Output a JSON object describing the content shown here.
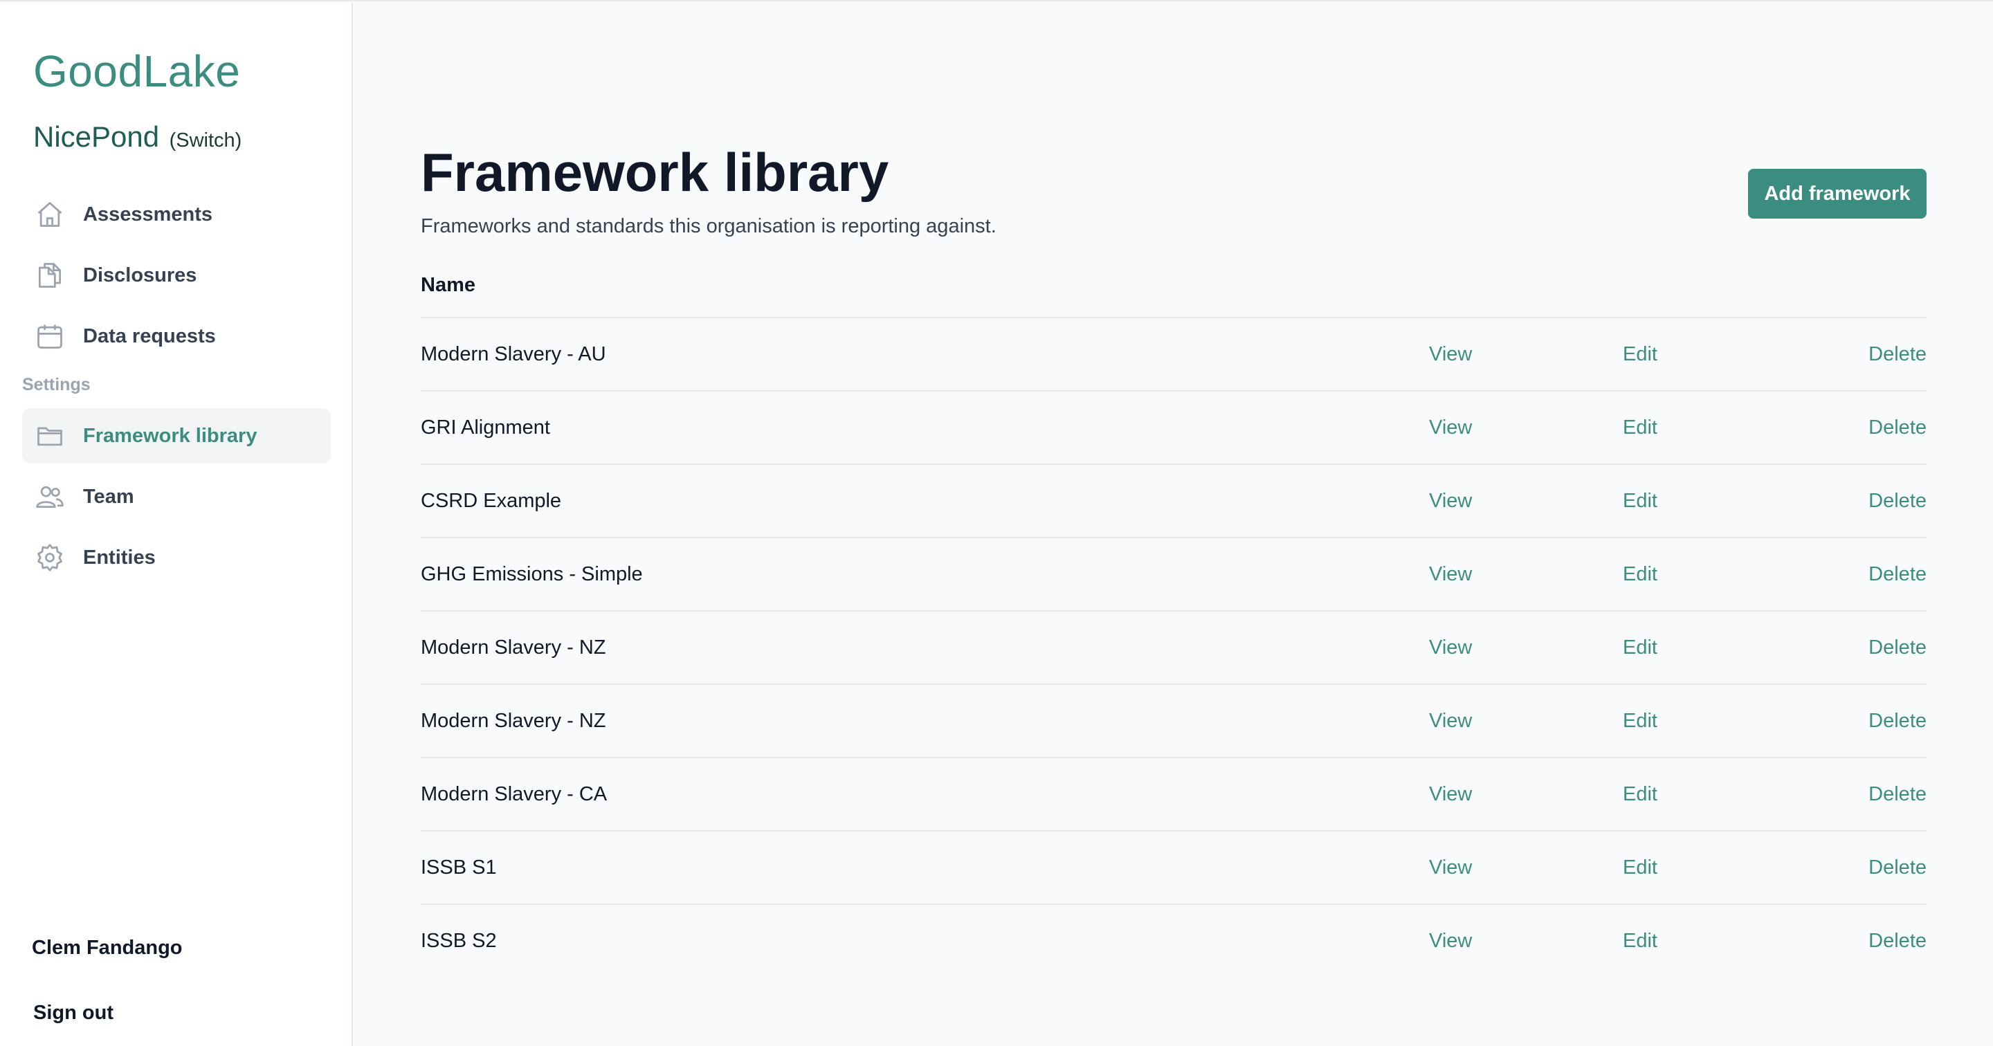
{
  "brand": "GoodLake",
  "org": {
    "name": "NicePond",
    "switch_label": "(Switch)"
  },
  "nav": {
    "items": [
      {
        "label": "Assessments",
        "icon": "home-icon"
      },
      {
        "label": "Disclosures",
        "icon": "documents-icon"
      },
      {
        "label": "Data requests",
        "icon": "calendar-icon"
      }
    ],
    "settings_label": "Settings",
    "settings_items": [
      {
        "label": "Framework library",
        "icon": "folder-icon",
        "active": true
      },
      {
        "label": "Team",
        "icon": "users-icon"
      },
      {
        "label": "Entities",
        "icon": "gear-icon"
      }
    ]
  },
  "user": {
    "name": "Clem Fandango",
    "signout_label": "Sign out"
  },
  "page": {
    "title": "Framework library",
    "description": "Frameworks and standards this organisation is reporting against.",
    "add_button": "Add framework"
  },
  "table": {
    "header_name": "Name",
    "actions": {
      "view": "View",
      "edit": "Edit",
      "delete": "Delete"
    },
    "rows": [
      {
        "name": "Modern Slavery - AU"
      },
      {
        "name": "GRI Alignment"
      },
      {
        "name": "CSRD Example"
      },
      {
        "name": "GHG Emissions - Simple"
      },
      {
        "name": "Modern Slavery - NZ"
      },
      {
        "name": "Modern Slavery - NZ"
      },
      {
        "name": "Modern Slavery - CA"
      },
      {
        "name": "ISSB S1"
      },
      {
        "name": "ISSB S2"
      }
    ]
  },
  "colors": {
    "accent": "#3b8d7f",
    "text": "#111827",
    "muted": "#9ca3af",
    "border": "#e5e7eb"
  }
}
